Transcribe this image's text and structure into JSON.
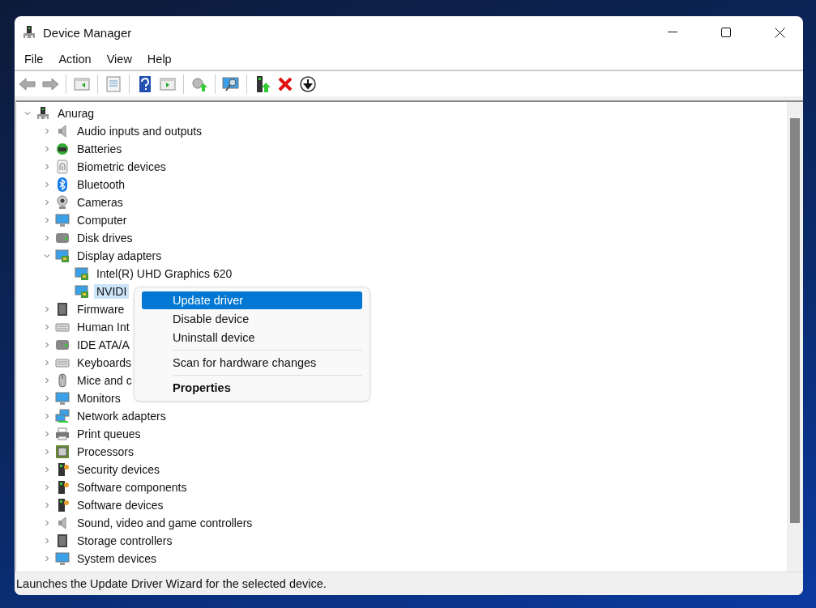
{
  "window": {
    "title": "Device Manager"
  },
  "menu_bar": [
    "File",
    "Action",
    "View",
    "Help"
  ],
  "tree": {
    "label": "Anurag",
    "kind": "computer",
    "expanded": true,
    "selected": false,
    "children": [
      {
        "label": "Audio inputs and outputs",
        "kind": "speaker",
        "expanded": false,
        "selected": false
      },
      {
        "label": "Batteries",
        "kind": "battery",
        "expanded": false,
        "selected": false
      },
      {
        "label": "Biometric devices",
        "kind": "fingerprint",
        "expanded": false,
        "selected": false
      },
      {
        "label": "Bluetooth",
        "kind": "bluetooth",
        "expanded": false,
        "selected": false
      },
      {
        "label": "Cameras",
        "kind": "webcam",
        "expanded": false,
        "selected": false
      },
      {
        "label": "Computer",
        "kind": "monitor",
        "expanded": false,
        "selected": false
      },
      {
        "label": "Disk drives",
        "kind": "drive",
        "expanded": false,
        "selected": false
      },
      {
        "label": "Display adapters",
        "kind": "display",
        "expanded": true,
        "selected": false,
        "children": [
          {
            "label": "Intel(R) UHD Graphics 620",
            "kind": "display",
            "selected": false
          },
          {
            "label": "NVIDI",
            "kind": "display",
            "selected": true
          }
        ]
      },
      {
        "label": "Firmware",
        "kind": "chip",
        "expanded": false,
        "selected": false
      },
      {
        "label": "Human Int",
        "kind": "keyboard",
        "expanded": false,
        "selected": false
      },
      {
        "label": "IDE ATA/A",
        "kind": "drive",
        "expanded": false,
        "selected": false
      },
      {
        "label": "Keyboards",
        "kind": "keyboard",
        "expanded": false,
        "selected": false
      },
      {
        "label": "Mice and c",
        "kind": "mouse",
        "expanded": false,
        "selected": false
      },
      {
        "label": "Monitors",
        "kind": "monitor",
        "expanded": false,
        "selected": false
      },
      {
        "label": "Network adapters",
        "kind": "network",
        "expanded": false,
        "selected": false
      },
      {
        "label": "Print queues",
        "kind": "printer",
        "expanded": false,
        "selected": false
      },
      {
        "label": "Processors",
        "kind": "processor",
        "expanded": false,
        "selected": false
      },
      {
        "label": "Security devices",
        "kind": "tower",
        "expanded": false,
        "selected": false
      },
      {
        "label": "Software components",
        "kind": "tower",
        "expanded": false,
        "selected": false
      },
      {
        "label": "Software devices",
        "kind": "tower",
        "expanded": false,
        "selected": false
      },
      {
        "label": "Sound, video and game controllers",
        "kind": "speaker",
        "expanded": false,
        "selected": false
      },
      {
        "label": "Storage controllers",
        "kind": "chip",
        "expanded": false,
        "selected": false
      },
      {
        "label": "System devices",
        "kind": "monitor",
        "expanded": false,
        "selected": false
      }
    ]
  },
  "context_menu": [
    {
      "kind": "item",
      "label": "Update driver",
      "selected": true,
      "default": false
    },
    {
      "kind": "item",
      "label": "Disable device",
      "selected": false,
      "default": false
    },
    {
      "kind": "item",
      "label": "Uninstall device",
      "selected": false,
      "default": false
    },
    {
      "kind": "separator"
    },
    {
      "kind": "item",
      "label": "Scan for hardware changes",
      "selected": false,
      "default": false
    },
    {
      "kind": "separator"
    },
    {
      "kind": "item",
      "label": "Properties",
      "selected": false,
      "default": true
    }
  ],
  "status_bar": "Launches the Update Driver Wizard for the selected device."
}
